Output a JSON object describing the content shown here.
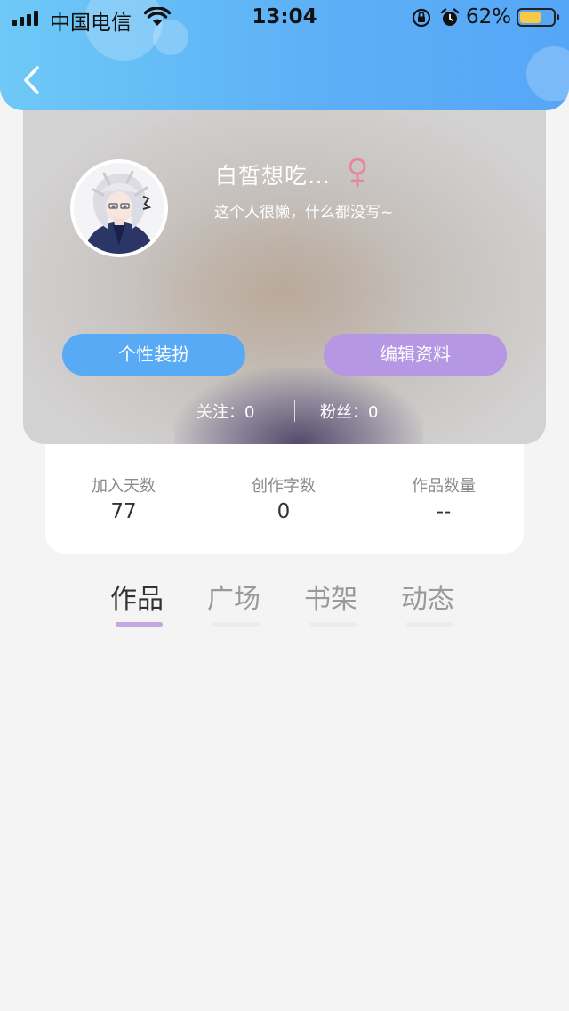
{
  "status_bar": {
    "carrier": "中国电信",
    "time": "13:04",
    "battery": "62%"
  },
  "header": {
    "back_icon": "chevron-left-icon",
    "gradient": [
      "#6ec9f7",
      "#56a6f7"
    ]
  },
  "profile": {
    "nickname": "白皙想吃…",
    "gender_icon": "female-symbol-icon",
    "gender_color": "#e8879c",
    "signature": "这个人很懒，什么都没写~",
    "dress_button": "个性装扮",
    "edit_button": "编辑资料",
    "follow_text": "关注：0",
    "fans_text": "粉丝：0"
  },
  "stats": [
    {
      "label": "加入天数",
      "value": "77"
    },
    {
      "label": "创作字数",
      "value": "0"
    },
    {
      "label": "作品数量",
      "value": "--"
    }
  ],
  "tabs": [
    {
      "label": "作品",
      "active": true
    },
    {
      "label": "广场",
      "active": false
    },
    {
      "label": "书架",
      "active": false
    },
    {
      "label": "动态",
      "active": false
    }
  ],
  "colors": {
    "dress_button": "#58aaf5",
    "edit_button": "#b597e3",
    "active_tab_indicator": "#c3a7e0"
  }
}
